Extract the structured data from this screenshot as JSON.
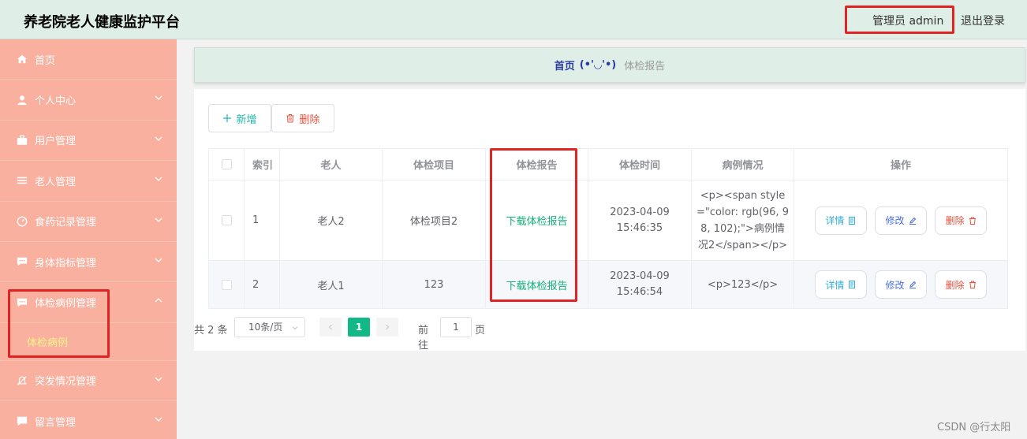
{
  "header": {
    "title": "养老院老人健康监护平台",
    "admin_label": "管理员 admin",
    "logout": "退出登录"
  },
  "sidebar": {
    "items": [
      {
        "label": "首页",
        "icon": "home-icon"
      },
      {
        "label": "个人中心",
        "icon": "user-icon"
      },
      {
        "label": "用户管理",
        "icon": "briefcase-icon"
      },
      {
        "label": "老人管理",
        "icon": "list-icon"
      },
      {
        "label": "食药记录管理",
        "icon": "dashboard-icon"
      },
      {
        "label": "身体指标管理",
        "icon": "chat-icon"
      },
      {
        "label": "体检病例管理",
        "icon": "chat-icon"
      },
      {
        "label": "突发情况管理",
        "icon": "bell-off-icon"
      },
      {
        "label": "留言管理",
        "icon": "message-icon"
      }
    ],
    "submenu_active": "体检病例"
  },
  "breadcrumb": {
    "home": "首页",
    "separator": "(•'◡'•)",
    "current": "体检报告"
  },
  "toolbar": {
    "add_label": "新增",
    "delete_label": "删除"
  },
  "table": {
    "headers": [
      "",
      "索引",
      "老人",
      "体检项目",
      "体检报告",
      "体检时间",
      "病例情况",
      "操作"
    ],
    "rows": [
      {
        "index": "1",
        "elder": "老人2",
        "item": "体检项目2",
        "report": "下载体检报告",
        "time": "2023-04-09 15:46:35",
        "case": "<p><span style=\"color: rgb(96, 98, 102);\">病例情况2</span></p>"
      },
      {
        "index": "2",
        "elder": "老人1",
        "item": "123",
        "report": "下载体检报告",
        "time": "2023-04-09 15:46:54",
        "case": "<p>123</p>"
      }
    ],
    "actions": {
      "detail": "详情",
      "edit": "修改",
      "remove": "删除"
    }
  },
  "pagination": {
    "total": "共 2 条",
    "page_size": "10条/页",
    "current_page": "1",
    "goto_label": "前往",
    "goto_value": "1",
    "page_unit": "页"
  },
  "watermark": "CSDN @行太阳",
  "colors": {
    "header_bg": "#dfeee7",
    "sidebar_bg": "#f9b09f",
    "accent_green": "#12b886",
    "highlight_red": "#e02424"
  }
}
